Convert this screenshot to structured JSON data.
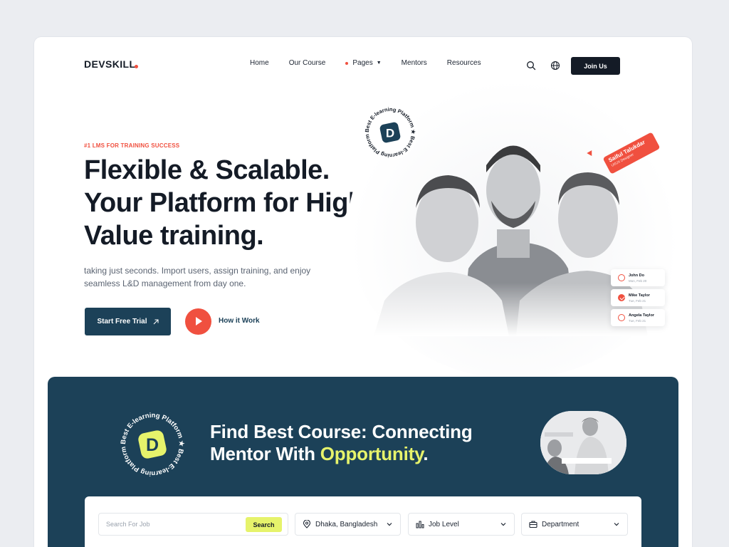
{
  "nav": {
    "logo": "DEVSKILL",
    "items": [
      {
        "label": "Home"
      },
      {
        "label": "Our Course"
      },
      {
        "label": "Pages"
      },
      {
        "label": "Mentors"
      },
      {
        "label": "Resources"
      }
    ],
    "join_label": "Join Us",
    "icons": [
      "search-icon",
      "globe-icon"
    ]
  },
  "hero": {
    "eyebrow": "#1 LMS FOR TRAINING SUCCESS",
    "headline_line1": "Flexible & Scalable.",
    "headline_line2": "Your Platform for High",
    "headline_line3": "Value training.",
    "sub_line1": "taking just seconds. Import users, assign training, and enjoy",
    "sub_line2": "seamless L&D management from day one.",
    "cta_label": "Start Free Trial",
    "how_label": "How it Work",
    "badge_text": "Best E-learning Platform",
    "badge_letter": "D",
    "tag_name": "Saiful Talukdar",
    "tag_role": "UI/UX Designer",
    "tasks": [
      {
        "name": "John Do",
        "date": "Mon, Feb 20",
        "done": false
      },
      {
        "name": "Mike Taylor",
        "date": "Tue, Feb 21",
        "done": true
      },
      {
        "name": "Angela Taylor",
        "date": "Tue, Feb 21",
        "done": false
      }
    ]
  },
  "find": {
    "title_line1": "Find Best Course: Connecting",
    "title_line2_a": "Mentor With ",
    "title_line2_b": "Opportunity",
    "title_line2_c": ".",
    "badge_text": "Best E-learning Platform",
    "badge_letter": "D"
  },
  "search": {
    "placeholder": "Search For Job",
    "button_label": "Search",
    "location": "Dhaka, Bangladesh",
    "level": "Job Level",
    "department": "Department"
  },
  "colors": {
    "accent": "#f0503f",
    "dark": "#1c4158",
    "lime": "#e6f36b",
    "ink": "#141b26"
  }
}
